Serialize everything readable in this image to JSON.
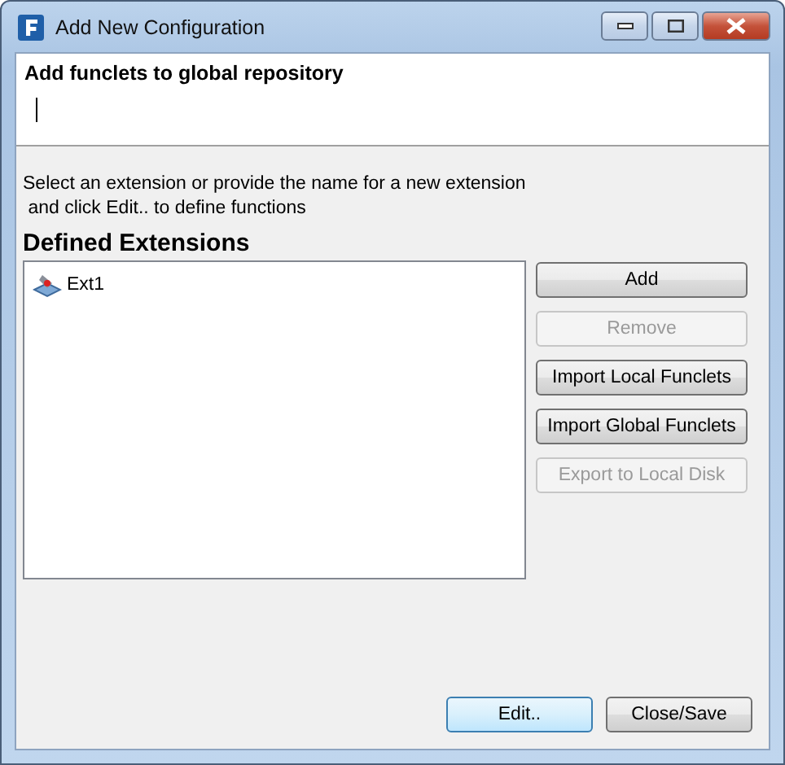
{
  "window": {
    "title": "Add New Configuration"
  },
  "header": {
    "title": "Add funclets to global repository"
  },
  "instructions": "Select an extension or provide the name for a new extension\n and click Edit.. to define functions",
  "extensions": {
    "heading": "Defined Extensions",
    "items": [
      {
        "label": "Ext1",
        "selected": false
      }
    ]
  },
  "side_buttons": [
    {
      "label": "Add",
      "disabled": false
    },
    {
      "label": "Remove",
      "disabled": true
    },
    {
      "label": "Import Local Funclets",
      "disabled": false
    },
    {
      "label": "Import Global Funclets",
      "disabled": false
    },
    {
      "label": "Export to Local Disk",
      "disabled": true
    }
  ],
  "footer_buttons": [
    {
      "label": "Edit..",
      "default": true
    },
    {
      "label": "Close/Save",
      "default": false
    }
  ]
}
